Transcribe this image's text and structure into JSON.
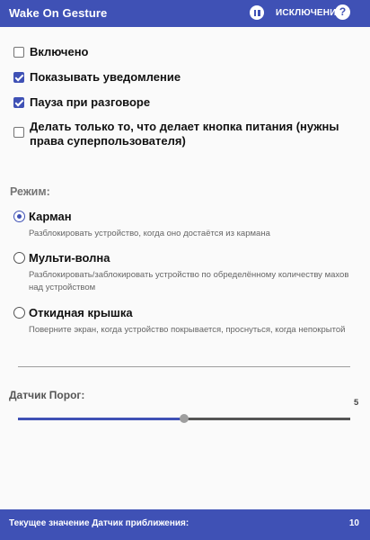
{
  "app_bar": {
    "title": "Wake On Gesture",
    "exceptions_label": "ИСКЛЮЧЕНИЯ",
    "help_glyph": "?",
    "bg_color": "#3f51b5"
  },
  "options": [
    {
      "label": "Включено",
      "checked": false
    },
    {
      "label": "Показывать уведомление",
      "checked": true
    },
    {
      "label": "Пауза при разговоре",
      "checked": true
    },
    {
      "label": "Делать только то, что делает кнопка питания (нужны права суперпользователя)",
      "checked": false
    }
  ],
  "mode": {
    "section_label": "Режим:",
    "items": [
      {
        "title": "Карман",
        "description": "Разблокировать устройство, когда оно достаётся из кармана",
        "selected": true
      },
      {
        "title": "Мульти-волна",
        "description": "Разблокировать/заблокировать устройство по обределённому количеству махов над устройством",
        "selected": false
      },
      {
        "title": "Откидная крышка",
        "description": "Поверните экран, когда устройство покрывается, проснуться, когда непокрытой",
        "selected": false
      }
    ]
  },
  "sensor": {
    "label": "Датчик Порог:",
    "value": "5",
    "slider_fraction": 0.5
  },
  "footer": {
    "text": "Текущее значение Датчик приближения:",
    "value": "10"
  }
}
